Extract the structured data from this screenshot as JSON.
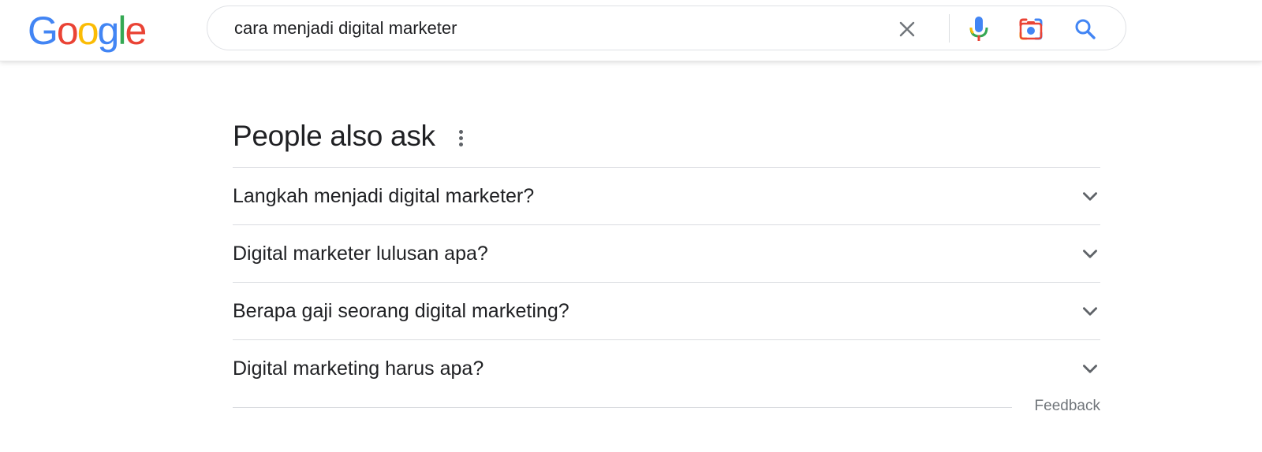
{
  "logo": {
    "letters": [
      "G",
      "o",
      "o",
      "g",
      "l",
      "e"
    ],
    "colors": [
      "#4285F4",
      "#EA4335",
      "#FBBC05",
      "#4285F4",
      "#34A853",
      "#EA4335"
    ]
  },
  "search": {
    "value": "cara menjadi digital marketer",
    "icons": [
      "clear-icon",
      "mic-icon",
      "camera-lens-icon",
      "search-icon"
    ]
  },
  "paa": {
    "title": "People also ask",
    "questions": [
      {
        "text": "Langkah menjadi digital marketer?"
      },
      {
        "text": "Digital marketer lulusan apa?"
      },
      {
        "text": "Berapa gaji seorang digital marketing?"
      },
      {
        "text": "Digital marketing harus apa?"
      }
    ],
    "feedback": "Feedback"
  },
  "colors": {
    "accent_blue": "#4285F4",
    "text": "#202124",
    "muted": "#70757a",
    "divider": "#dadce0"
  }
}
